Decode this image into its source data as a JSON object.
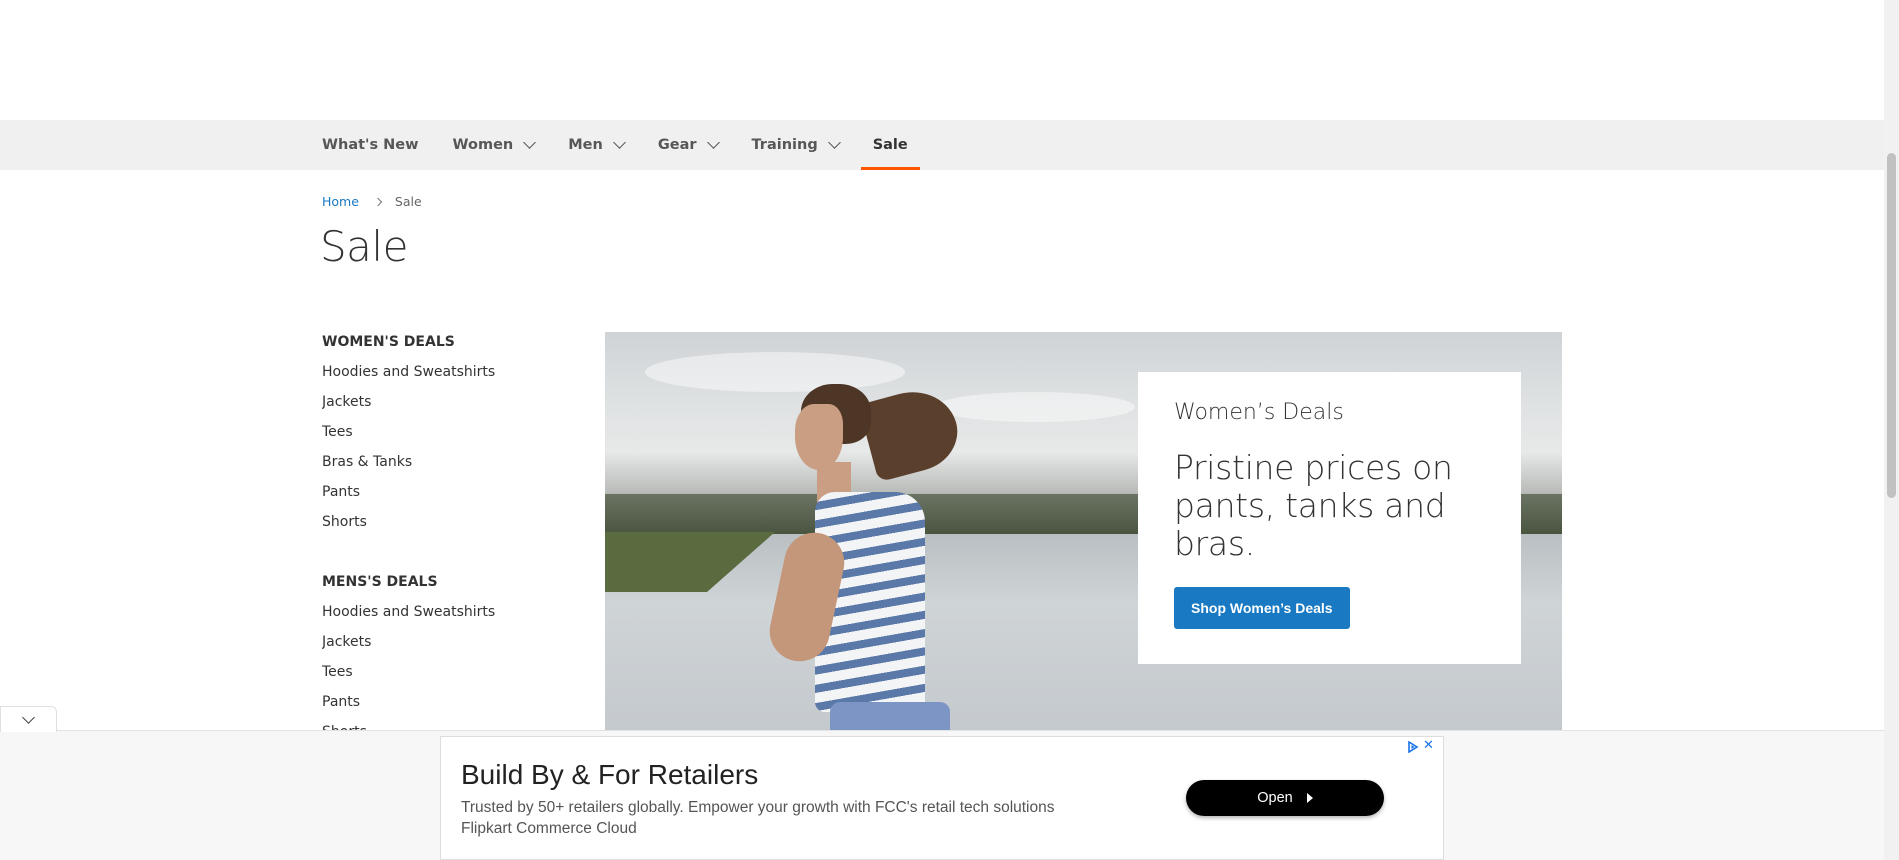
{
  "nav": {
    "items": [
      {
        "label": "What's New",
        "has_dropdown": false
      },
      {
        "label": "Women",
        "has_dropdown": true
      },
      {
        "label": "Men",
        "has_dropdown": true
      },
      {
        "label": "Gear",
        "has_dropdown": true
      },
      {
        "label": "Training",
        "has_dropdown": true
      },
      {
        "label": "Sale",
        "has_dropdown": false,
        "active": true
      }
    ],
    "active_color": "#ff5501"
  },
  "breadcrumb": {
    "home": "Home",
    "current": "Sale"
  },
  "page_title": "Sale",
  "sidebar": {
    "womens": {
      "heading": "WOMEN'S DEALS",
      "links": [
        "Hoodies and Sweatshirts",
        "Jackets",
        "Tees",
        "Bras & Tanks",
        "Pants",
        "Shorts"
      ]
    },
    "mens": {
      "heading": "MENS'S DEALS",
      "links": [
        "Hoodies and Sweatshirts",
        "Jackets",
        "Tees",
        "Pants",
        "Shorts"
      ]
    }
  },
  "hero": {
    "kicker": "Women’s Deals",
    "headline": "Pristine prices on pants, tanks and bras.",
    "button_label": "Shop Women’s Deals",
    "button_color": "#1979c3"
  },
  "ad": {
    "title": "Build By & For Retailers",
    "description_line1": "Trusted by 50+ retailers globally. Empower your growth with FCC's retail tech solutions",
    "description_line2": "Flipkart Commerce Cloud",
    "open_label": "Open",
    "icons": [
      "chevron-down-icon",
      "adchoices-icon",
      "close-icon"
    ]
  }
}
